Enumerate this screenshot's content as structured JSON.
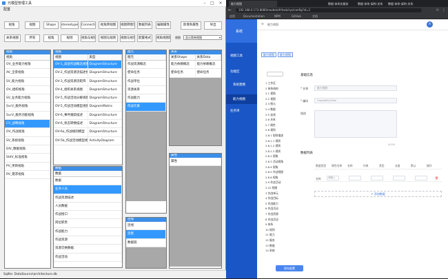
{
  "app": {
    "title": "元模型管理工具",
    "menu": "配置",
    "toolbar": [
      "视角",
      "视图",
      "Shape",
      "stereotype",
      "Connection",
      "视角转视图",
      "视图转图元",
      "数据列表",
      "编辑属性",
      "",
      "关系视图",
      "所有",
      "视角",
      "规则",
      "视角与规则",
      "视图与规则",
      "视图与视角",
      "配置格式",
      "视角视图属性"
    ],
    "right_buttons": [
      "新增系属性",
      "导出"
    ],
    "combo_label": "视图",
    "combo_value": "显示简单视图",
    "panels": {
      "viewpoint": {
        "header": "视角",
        "col": "视角",
        "rows": [
          "OV_业务能力视角",
          "AV_全景视角",
          "SV_能力视角",
          "OV_组织视角",
          "SV_业务能力视角",
          "SvcV_服务视角",
          "SvcV_服务功能视角",
          "CV_战略视角",
          "OV_作战视角",
          "SV_系统视角",
          "DIV_数据视角",
          "StdV_标准视角",
          "PV_项目视角",
          "RV_需求视角"
        ],
        "selected": 7
      },
      "view": {
        "header": "视图",
        "cols": [
          "视图",
          "类型"
        ],
        "rows": [
          [
            "OV-1_高层作战概念视图",
            "DiagramStructure"
          ],
          [
            "OV-2_作战资源流描述视图",
            "DiagramStructure"
          ],
          [
            "OV-3_作战资源流矩阵",
            "DiagramStructure"
          ],
          [
            "OV-4_组织关系视图",
            "DiagramStructure"
          ],
          [
            "OV-5_作战活动分解视图",
            "DiagramStructure"
          ],
          [
            "OV-5_作战活动模型视图",
            "DiagramMatrix"
          ],
          [
            "OV-6_事件跟踪描述",
            "DiagramStructure"
          ],
          [
            "OV-6_状态转换描述",
            "DiagramStructure"
          ],
          [
            "OV-6a_作战规则模型",
            "DiagramStructure"
          ],
          [
            "OV-5b_作战活动模型视图",
            "ActivityDiagram"
          ]
        ],
        "selected": 0
      },
      "shape": {
        "header": "图元",
        "col": "图元",
        "rows": [
          "作战资源概念",
          "使命任务",
          "作战单位",
          "资源关系",
          "作战能力",
          "作战元素"
        ],
        "selected": 5
      },
      "relation": {
        "header": "关系",
        "cols": [
          "关系Shape",
          "关系Data"
        ],
        "rows": [
          [
            "能力依赖概念",
            "能力依赖概念"
          ],
          [
            "使命任务",
            "使命任务"
          ]
        ]
      },
      "data": {
        "header": "数据",
        "col": "数据",
        "rows": [
          "数据",
          "业务人员",
          "作战资源描述",
          "人员数据",
          "作战接口",
          "岗位职责",
          "作战能力",
          "作战资源",
          "资源交换数据",
          "作战活动"
        ],
        "selected": 1
      },
      "props": {
        "header": "属性",
        "rows": [
          "属性"
        ]
      },
      "conn": {
        "header": "连线",
        "rows": [
          "连线",
          "连接",
          "数据链"
        ],
        "selected": 1
      }
    },
    "status": "SqlIte: DataSource\\architecture.db"
  },
  "browser": {
    "tabs": [
      "能力视图",
      "数据-体系化服务",
      "数据-体系-架构-关系",
      "数据-体系-架构-关系-体系"
    ],
    "url": "192.168.0.173:8080/models/#/task/sys/config?id=1",
    "bookmarks": [
      "应用",
      "Documentation",
      "NPM",
      "GitHub",
      "文档"
    ],
    "side_items": [
      "视图工具",
      "功能区",
      "系统建模",
      "能力视图",
      "任务项"
    ],
    "logo": "系统",
    "topbar_title": "能力视图",
    "avatar_letter": "A",
    "tab_pills": [
      "能力视图",
      "能力视图"
    ],
    "tree_search": "",
    "tree": [
      "1 工作区",
      "2 体系结构",
      "  2.1 视角",
      "  2.2 视图",
      "  2.3 图元",
      "  2.4 数据",
      "  2.5 连线",
      "  2.6 关系",
      "  2.7 属性",
      "  2.8 规则",
      "    2.8.1 规则描述",
      "      2.8.1.1 规则",
      "      2.8.1.2 规则",
      "      2.8.1.3 规则",
      "    2.8.2 视角",
      "    2.8.3 活动视角",
      "    2.8.4 视角",
      "    2.8.5 作战视图",
      "    2.8.6 视角",
      "  2.9 作战活动",
      "  2.10 视图",
      "3 作战单元",
      "4 作战目标",
      "5 作战能力",
      "6 作战活动",
      "7 作战资源",
      "8 作战活动",
      "9 体系",
      "10 规则",
      "11 能力",
      "12 服务",
      "13 数据",
      "14 系统"
    ],
    "form_title": "基础信息",
    "fields": [
      {
        "label": "* 名称",
        "value": "能力视图"
      },
      {
        "label": "* 编码",
        "value": "CapabilityView"
      },
      {
        "label": "描述",
        "value": ""
      }
    ],
    "counter": "0/200",
    "table_title": "数据列表",
    "table_cols": [
      "数据类型",
      "属性名称",
      "名称",
      "约束",
      "类型",
      "长度",
      "默认",
      "操作"
    ],
    "table_row": [
      "名称",
      "请输入",
      "",
      "",
      "",
      "",
      "",
      ""
    ],
    "add_row": "+ 添加数据",
    "save": "保存配置",
    "colors": {
      "side": "#1a56c6",
      "accent": "#3399ff",
      "header": "#3d8ee6"
    }
  }
}
